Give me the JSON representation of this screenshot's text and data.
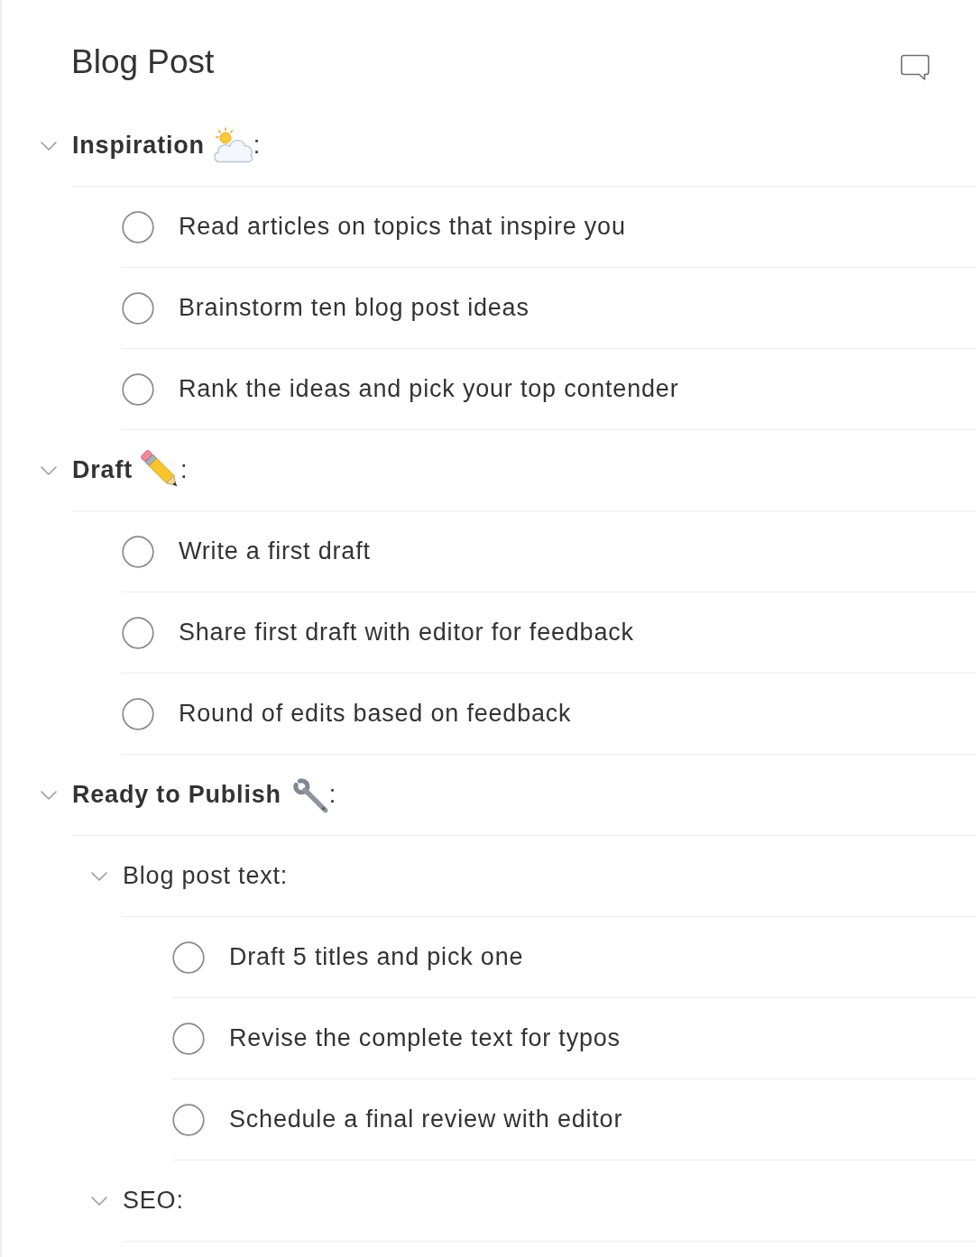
{
  "page": {
    "title": "Blog Post"
  },
  "outline": [
    {
      "kind": "section",
      "label": "Inspiration",
      "suffix": ":",
      "expanded": true,
      "children": [
        {
          "kind": "task",
          "label": "Read articles on topics that inspire you",
          "checked": false
        },
        {
          "kind": "task",
          "label": "Brainstorm ten blog post ideas",
          "checked": false
        },
        {
          "kind": "task",
          "label": "Rank the ideas and pick your top contender",
          "checked": false
        }
      ]
    },
    {
      "kind": "section",
      "label": "Draft",
      "suffix": ":",
      "expanded": true,
      "children": [
        {
          "kind": "task",
          "label": "Write a first draft",
          "checked": false
        },
        {
          "kind": "task",
          "label": "Share first draft with editor for feedback",
          "checked": false
        },
        {
          "kind": "task",
          "label": "Round of edits based on feedback",
          "checked": false
        }
      ]
    },
    {
      "kind": "section",
      "label": "Ready to Publish",
      "suffix": ":",
      "expanded": true,
      "children": [
        {
          "kind": "group",
          "label": "Blog post text:",
          "expanded": true,
          "children": [
            {
              "kind": "task",
              "label": "Draft 5 titles and pick one",
              "checked": false
            },
            {
              "kind": "task",
              "label": "Revise the complete text for typos",
              "checked": false
            },
            {
              "kind": "task",
              "label": "Schedule a final review with editor",
              "checked": false
            }
          ]
        },
        {
          "kind": "group",
          "label": "SEO:",
          "expanded": true
        }
      ]
    }
  ]
}
